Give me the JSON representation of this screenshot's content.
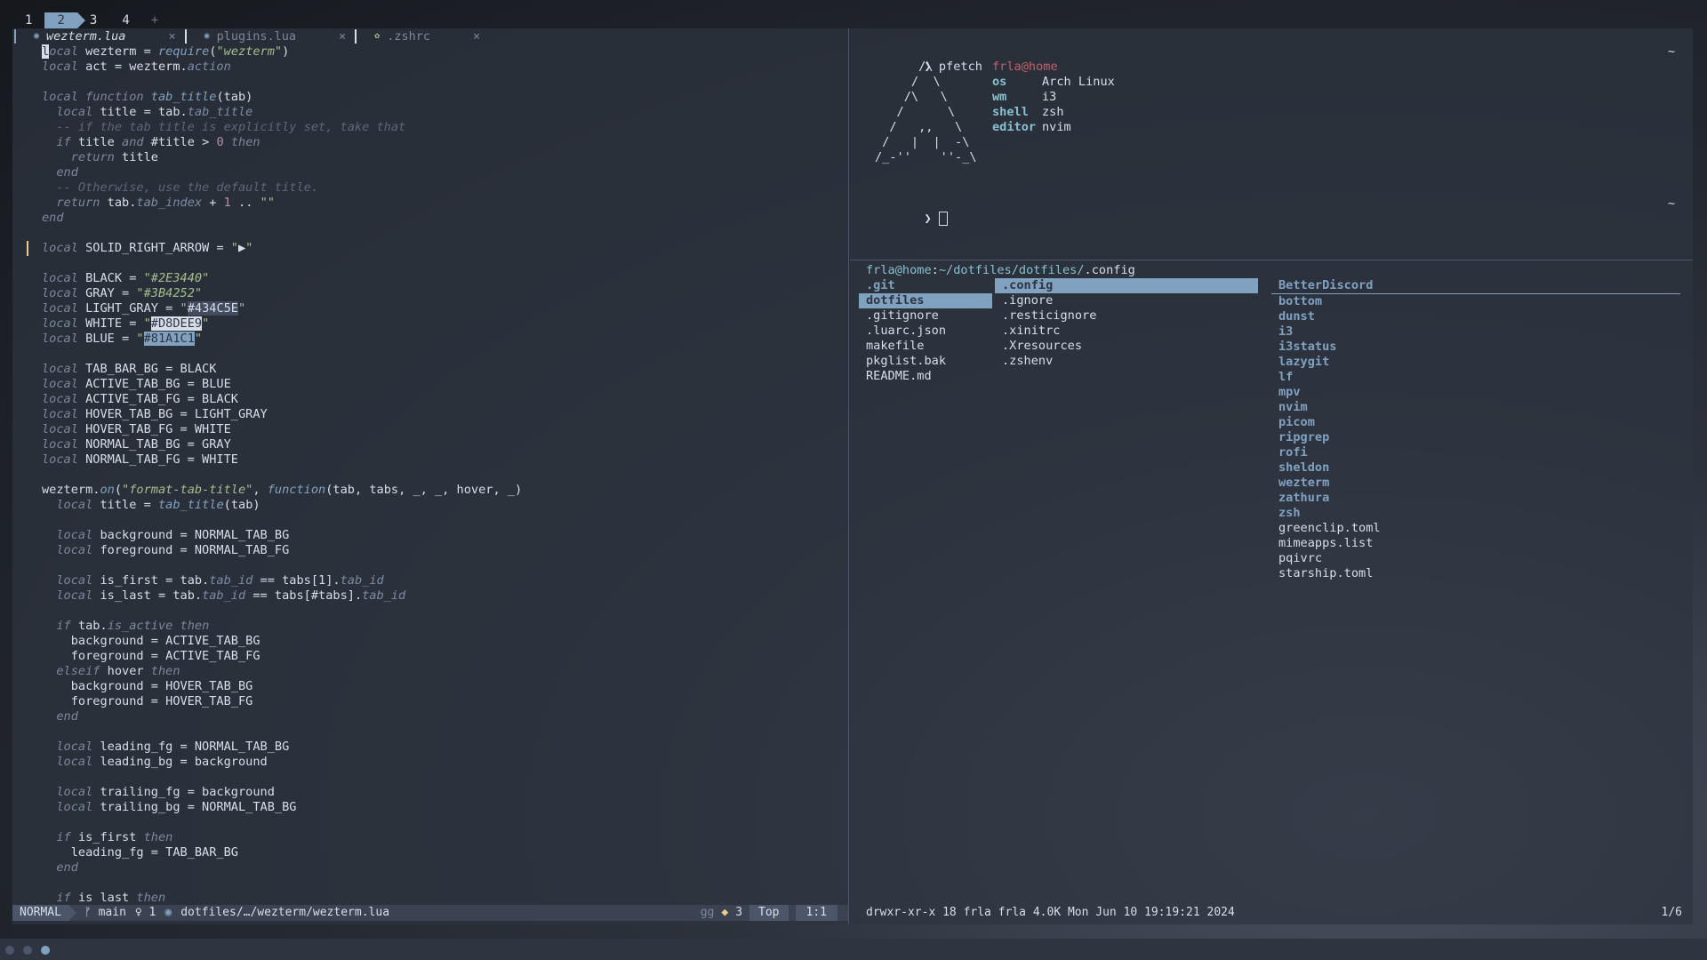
{
  "workspaces": [
    "1",
    "2",
    "3",
    "4"
  ],
  "active_workspace": "2",
  "workspace_add": "+",
  "tabs": [
    {
      "label": "wezterm.lua",
      "close": "×"
    },
    {
      "label": "plugins.lua",
      "close": "×"
    },
    {
      "label": ".zshrc",
      "close": "×"
    }
  ],
  "editor": {
    "lines": [
      [
        [
          "cursor",
          "l"
        ],
        [
          "kw",
          "ocal "
        ],
        [
          "id",
          "wezterm"
        ],
        [
          "id",
          " = "
        ],
        [
          "fn",
          "require"
        ],
        [
          "id",
          "("
        ],
        [
          "str",
          "\"wezterm\""
        ],
        [
          "id",
          ")"
        ]
      ],
      [
        [
          "kw",
          "local "
        ],
        [
          "id",
          "act = wezterm."
        ],
        [
          "prop",
          "action"
        ]
      ],
      [],
      [
        [
          "kw",
          "local function "
        ],
        [
          "fn",
          "tab_title"
        ],
        [
          "id",
          "(tab)"
        ]
      ],
      [
        [
          "id",
          "  "
        ],
        [
          "kw",
          "local "
        ],
        [
          "id",
          "title = tab."
        ],
        [
          "prop",
          "tab_title"
        ]
      ],
      [
        [
          "com",
          "  -- if the tab title is explicitly set, take that"
        ]
      ],
      [
        [
          "id",
          "  "
        ],
        [
          "kw",
          "if "
        ],
        [
          "id",
          "title "
        ],
        [
          "kw",
          "and "
        ],
        [
          "id",
          "#title > "
        ],
        [
          "num",
          "0 "
        ],
        [
          "kw",
          "then"
        ]
      ],
      [
        [
          "id",
          "    "
        ],
        [
          "kw",
          "return "
        ],
        [
          "id",
          "title"
        ]
      ],
      [
        [
          "id",
          "  "
        ],
        [
          "kw",
          "end"
        ]
      ],
      [
        [
          "com",
          "  -- Otherwise, use the default title."
        ]
      ],
      [
        [
          "id",
          "  "
        ],
        [
          "kw",
          "return "
        ],
        [
          "id",
          "tab."
        ],
        [
          "prop",
          "tab_index"
        ],
        [
          "id",
          " + "
        ],
        [
          "num",
          "1"
        ],
        [
          "id",
          " .. "
        ],
        [
          "str",
          "\"\""
        ]
      ],
      [
        [
          "kw",
          "end"
        ]
      ],
      [],
      [
        [
          "kw",
          "local "
        ],
        [
          "id",
          "SOLID_RIGHT_ARROW = "
        ],
        [
          "str",
          "\""
        ],
        [
          "id",
          "▶"
        ],
        [
          "str",
          "\""
        ]
      ],
      [],
      [
        [
          "kw",
          "local "
        ],
        [
          "id",
          "BLACK = "
        ],
        [
          "str",
          "\"#2E3440\""
        ]
      ],
      [
        [
          "kw",
          "local "
        ],
        [
          "id",
          "GRAY = "
        ],
        [
          "str",
          "\"#3B4252\""
        ]
      ],
      [
        [
          "kw",
          "local "
        ],
        [
          "id",
          "LIGHT_GRAY = "
        ],
        [
          "str",
          "\""
        ],
        [
          "hlgray",
          "#434C5E"
        ],
        [
          "str",
          "\""
        ]
      ],
      [
        [
          "kw",
          "local "
        ],
        [
          "id",
          "WHITE = "
        ],
        [
          "str",
          "\""
        ],
        [
          "hl",
          "#D8DEE9"
        ],
        [
          "str",
          "\""
        ]
      ],
      [
        [
          "kw",
          "local "
        ],
        [
          "id",
          "BLUE = "
        ],
        [
          "str",
          "\""
        ],
        [
          "hlb",
          "#81A1C1"
        ],
        [
          "str",
          "\""
        ]
      ],
      [],
      [
        [
          "kw",
          "local "
        ],
        [
          "id",
          "TAB_BAR_BG = BLACK"
        ]
      ],
      [
        [
          "kw",
          "local "
        ],
        [
          "id",
          "ACTIVE_TAB_BG = BLUE"
        ]
      ],
      [
        [
          "kw",
          "local "
        ],
        [
          "id",
          "ACTIVE_TAB_FG = BLACK"
        ]
      ],
      [
        [
          "kw",
          "local "
        ],
        [
          "id",
          "HOVER_TAB_BG = LIGHT_GRAY"
        ]
      ],
      [
        [
          "kw",
          "local "
        ],
        [
          "id",
          "HOVER_TAB_FG = WHITE"
        ]
      ],
      [
        [
          "kw",
          "local "
        ],
        [
          "id",
          "NORMAL_TAB_BG = GRAY"
        ]
      ],
      [
        [
          "kw",
          "local "
        ],
        [
          "id",
          "NORMAL_TAB_FG = WHITE"
        ]
      ],
      [],
      [
        [
          "id",
          "wezterm."
        ],
        [
          "fn",
          "on"
        ],
        [
          "id",
          "("
        ],
        [
          "str",
          "\"format-tab-title\""
        ],
        [
          "id",
          ", "
        ],
        [
          "fn",
          "function"
        ],
        [
          "id",
          "(tab, tabs, _, _, hover, _)"
        ]
      ],
      [
        [
          "id",
          "  "
        ],
        [
          "kw",
          "local "
        ],
        [
          "id",
          "title = "
        ],
        [
          "fn",
          "tab_title"
        ],
        [
          "id",
          "(tab)"
        ]
      ],
      [],
      [
        [
          "id",
          "  "
        ],
        [
          "kw",
          "local "
        ],
        [
          "id",
          "background = NORMAL_TAB_BG"
        ]
      ],
      [
        [
          "id",
          "  "
        ],
        [
          "kw",
          "local "
        ],
        [
          "id",
          "foreground = NORMAL_TAB_FG"
        ]
      ],
      [],
      [
        [
          "id",
          "  "
        ],
        [
          "kw",
          "local "
        ],
        [
          "id",
          "is_first = tab."
        ],
        [
          "prop",
          "tab_id"
        ],
        [
          "id",
          " == tabs[1]."
        ],
        [
          "prop",
          "tab_id"
        ]
      ],
      [
        [
          "id",
          "  "
        ],
        [
          "kw",
          "local "
        ],
        [
          "id",
          "is_last = tab."
        ],
        [
          "prop",
          "tab_id"
        ],
        [
          "id",
          " == tabs[#tabs]."
        ],
        [
          "prop",
          "tab_id"
        ]
      ],
      [],
      [
        [
          "id",
          "  "
        ],
        [
          "kw",
          "if "
        ],
        [
          "id",
          "tab."
        ],
        [
          "prop",
          "is_active "
        ],
        [
          "kw",
          "then"
        ]
      ],
      [
        [
          "id",
          "    background = ACTIVE_TAB_BG"
        ]
      ],
      [
        [
          "id",
          "    foreground = ACTIVE_TAB_FG"
        ]
      ],
      [
        [
          "id",
          "  "
        ],
        [
          "kw",
          "elseif "
        ],
        [
          "id",
          "hover "
        ],
        [
          "kw",
          "then"
        ]
      ],
      [
        [
          "id",
          "    background = HOVER_TAB_BG"
        ]
      ],
      [
        [
          "id",
          "    foreground = HOVER_TAB_FG"
        ]
      ],
      [
        [
          "id",
          "  "
        ],
        [
          "kw",
          "end"
        ]
      ],
      [],
      [
        [
          "id",
          "  "
        ],
        [
          "kw",
          "local "
        ],
        [
          "id",
          "leading_fg = NORMAL_TAB_BG"
        ]
      ],
      [
        [
          "id",
          "  "
        ],
        [
          "kw",
          "local "
        ],
        [
          "id",
          "leading_bg = background"
        ]
      ],
      [],
      [
        [
          "id",
          "  "
        ],
        [
          "kw",
          "local "
        ],
        [
          "id",
          "trailing_fg = background"
        ]
      ],
      [
        [
          "id",
          "  "
        ],
        [
          "kw",
          "local "
        ],
        [
          "id",
          "trailing_bg = NORMAL_TAB_BG"
        ]
      ],
      [],
      [
        [
          "id",
          "  "
        ],
        [
          "kw",
          "if "
        ],
        [
          "id",
          "is_first "
        ],
        [
          "kw",
          "then"
        ]
      ],
      [
        [
          "id",
          "    leading_fg = TAB_BAR_BG"
        ]
      ],
      [
        [
          "id",
          "  "
        ],
        [
          "kw",
          "end"
        ]
      ],
      [],
      [
        [
          "id",
          "  "
        ],
        [
          "kw",
          "if "
        ],
        [
          "id",
          "is_last "
        ],
        [
          "kw",
          "then"
        ]
      ]
    ]
  },
  "statusline": {
    "mode": "NORMAL",
    "branch": "ᚠ main",
    "diag": "♀ 1",
    "file": "dotfiles/…/wezterm/wezterm.lua",
    "keys": "gg",
    "buffers": "3",
    "scroll": "Top",
    "pos": "1:1"
  },
  "pfetch": {
    "command": "pfetch",
    "prompt": "❯",
    "tilde": "~",
    "logo": [
      "      /\\",
      "     /  \\",
      "    /\\   \\",
      "   /      \\",
      "  /   ,,   \\",
      " /   |  |  -\\",
      "/_-''    ''-_\\"
    ],
    "user": "frla@home",
    "info": [
      [
        "os",
        "Arch Linux"
      ],
      [
        "wm",
        "i3"
      ],
      [
        "shell",
        "zsh"
      ],
      [
        "editor",
        "nvim"
      ]
    ]
  },
  "lf": {
    "header_user": "frla@home",
    "header_sep": ":",
    "header_path": "~/dotfiles/dotfiles/",
    "header_current": ".config",
    "col1": [
      {
        "name": ".git",
        "type": "dir",
        "selected": false
      },
      {
        "name": "dotfiles",
        "type": "dir",
        "selected": true
      },
      {
        "name": ".gitignore",
        "type": "file",
        "selected": false
      },
      {
        "name": ".luarc.json",
        "type": "file",
        "selected": false
      },
      {
        "name": "makefile",
        "type": "file",
        "selected": false
      },
      {
        "name": "pkglist.bak",
        "type": "file",
        "selected": false
      },
      {
        "name": "README.md",
        "type": "file",
        "selected": false
      }
    ],
    "col2": [
      {
        "name": ".config",
        "type": "dir",
        "selected": true
      },
      {
        "name": ".ignore",
        "type": "file",
        "selected": false
      },
      {
        "name": ".resticignore",
        "type": "file",
        "selected": false
      },
      {
        "name": ".xinitrc",
        "type": "file",
        "selected": false
      },
      {
        "name": ".Xresources",
        "type": "file",
        "selected": false
      },
      {
        "name": ".zshenv",
        "type": "file",
        "selected": false
      }
    ],
    "col3": [
      {
        "name": "BetterDiscord",
        "type": "dir"
      },
      {
        "name": "bottom",
        "type": "dir"
      },
      {
        "name": "dunst",
        "type": "dir"
      },
      {
        "name": "i3",
        "type": "dir"
      },
      {
        "name": "i3status",
        "type": "dir"
      },
      {
        "name": "lazygit",
        "type": "dir"
      },
      {
        "name": "lf",
        "type": "dir"
      },
      {
        "name": "mpv",
        "type": "dir"
      },
      {
        "name": "nvim",
        "type": "dir"
      },
      {
        "name": "picom",
        "type": "dir"
      },
      {
        "name": "ripgrep",
        "type": "dir"
      },
      {
        "name": "rofi",
        "type": "dir"
      },
      {
        "name": "sheldon",
        "type": "dir"
      },
      {
        "name": "wezterm",
        "type": "dir"
      },
      {
        "name": "zathura",
        "type": "dir"
      },
      {
        "name": "zsh",
        "type": "dir"
      },
      {
        "name": "greenclip.toml",
        "type": "file"
      },
      {
        "name": "mimeapps.list",
        "type": "file"
      },
      {
        "name": "pqivrc",
        "type": "file"
      },
      {
        "name": "starship.toml",
        "type": "file"
      }
    ],
    "status": "drwxr-xr-x 18 frla frla 4.0K Mon Jun 10 19:19:21 2024",
    "count": "1/6"
  },
  "colors": {
    "accent": "#81A1C1",
    "background": "#2E3440",
    "foreground": "#D8DEE9"
  }
}
